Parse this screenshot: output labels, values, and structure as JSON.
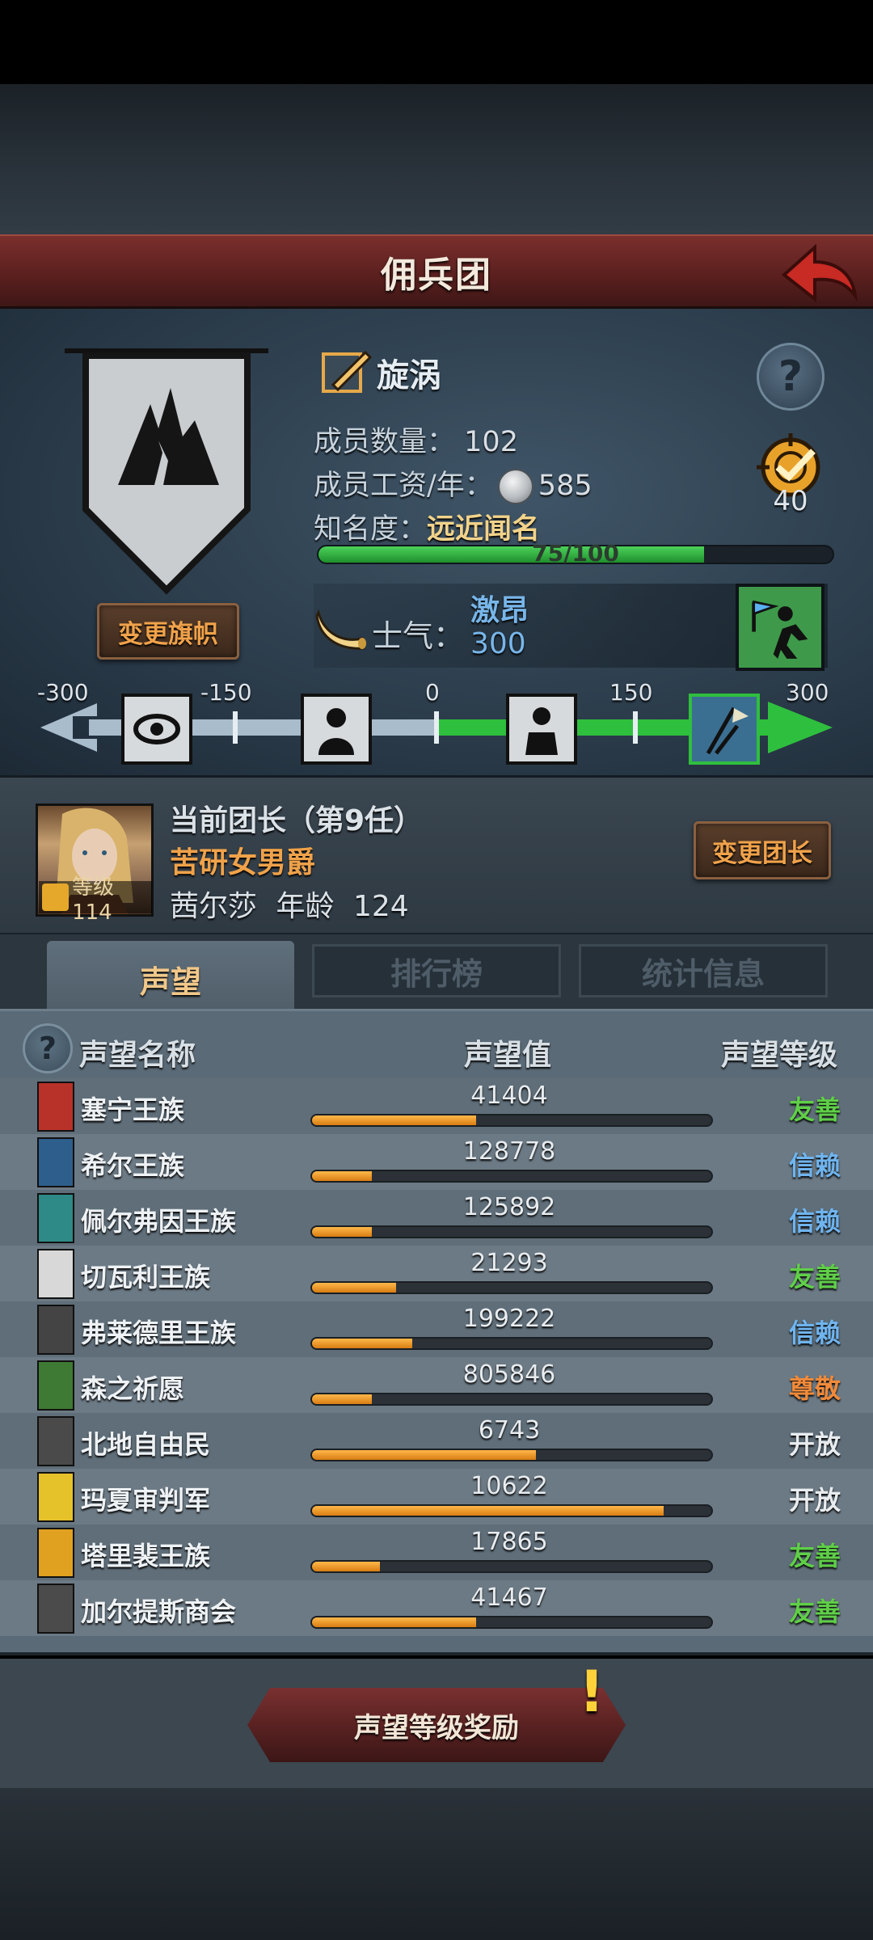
{
  "window": {
    "title": "佣兵团"
  },
  "guild": {
    "name": "旋涡",
    "change_banner_label": "变更旗帜",
    "members_label": "成员数量：",
    "members_value": "102",
    "wage_label": "成员工资/年：",
    "wage_value": "585",
    "fame_label": "知名度：",
    "fame_value": "远近闻名",
    "fame_progress_text": "75/100",
    "fame_progress": 0.75,
    "rank_value": "40"
  },
  "morale": {
    "label": "士气：",
    "state": "激昂",
    "value": "300",
    "scale_ticks": [
      "-300",
      "-150",
      "0",
      "150",
      "300"
    ],
    "level": 300
  },
  "leader": {
    "title": "当前团长（第9任）",
    "class": "苦研女男爵",
    "name": "茜尔莎",
    "age_label": "年龄",
    "age_value": "124",
    "level_label": "等级114",
    "change_label": "变更团长"
  },
  "tabs": [
    {
      "label": "声望"
    },
    {
      "label": "排行榜"
    },
    {
      "label": "统计信息"
    }
  ],
  "reputation": {
    "headers": {
      "name": "声望名称",
      "value": "声望值",
      "level": "声望等级"
    },
    "rows": [
      {
        "name": "塞宁王族",
        "value": "41404",
        "fill": 0.41,
        "level": "友善",
        "level_color": "#5fcf47",
        "crest_color": "#b8322a"
      },
      {
        "name": "希尔王族",
        "value": "128778",
        "fill": 0.15,
        "level": "信赖",
        "level_color": "#6fb4ef",
        "crest_color": "#2e5f8c"
      },
      {
        "name": "佩尔弗因王族",
        "value": "125892",
        "fill": 0.15,
        "level": "信赖",
        "level_color": "#6fb4ef",
        "crest_color": "#2e8a86"
      },
      {
        "name": "切瓦利王族",
        "value": "21293",
        "fill": 0.21,
        "level": "友善",
        "level_color": "#5fcf47",
        "crest_color": "#d8d8d8"
      },
      {
        "name": "弗莱德里王族",
        "value": "199222",
        "fill": 0.25,
        "level": "信赖",
        "level_color": "#6fb4ef",
        "crest_color": "#444444"
      },
      {
        "name": "森之祈愿",
        "value": "805846",
        "fill": 0.15,
        "level": "尊敬",
        "level_color": "#f08a3a",
        "crest_color": "#3f7a34"
      },
      {
        "name": "北地自由民",
        "value": "6743",
        "fill": 0.56,
        "level": "开放",
        "level_color": "#e8ecef",
        "crest_color": "#4a4a4a"
      },
      {
        "name": "玛夏审判军",
        "value": "10622",
        "fill": 0.88,
        "level": "开放",
        "level_color": "#e8ecef",
        "crest_color": "#e5c22a"
      },
      {
        "name": "塔里裴王族",
        "value": "17865",
        "fill": 0.17,
        "level": "友善",
        "level_color": "#5fcf47",
        "crest_color": "#e0a020"
      },
      {
        "name": "加尔提斯商会",
        "value": "41467",
        "fill": 0.41,
        "level": "友善",
        "level_color": "#5fcf47",
        "crest_color": "#4b4b4b"
      }
    ]
  },
  "reward_button": {
    "label": "声望等级奖励"
  },
  "icons": {
    "back": "back-arrow-icon",
    "help": "question-icon",
    "rank": "target-check-icon",
    "horn": "horn-icon",
    "coin": "silver-coin-icon"
  },
  "colors": {
    "title_bar": "#5c201f",
    "accent_orange": "#f0a24a",
    "morale_blue": "#78b6ea",
    "progress_green": "#2fbf3e"
  }
}
